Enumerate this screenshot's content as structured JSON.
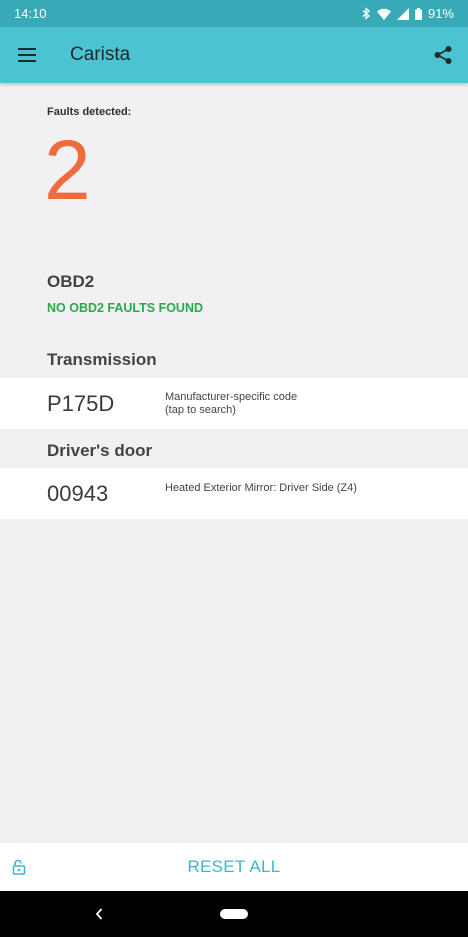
{
  "status_bar": {
    "time": "14:10",
    "battery": "91%"
  },
  "app_bar": {
    "title": "Carista"
  },
  "faults": {
    "label": "Faults detected:",
    "count": "2"
  },
  "sections": {
    "obd2": {
      "title": "OBD2",
      "status": "NO OBD2 FAULTS FOUND",
      "status_color": "#2aa84a"
    },
    "transmission": {
      "title": "Transmission",
      "code": "P175D",
      "desc_line1": "Manufacturer-specific code",
      "desc_line2": "(tap to search)"
    },
    "drivers_door": {
      "title": "Driver's door",
      "code": "00943",
      "desc_line1": "Heated Exterior Mirror: Driver Side (Z4)"
    }
  },
  "bottom_bar": {
    "reset_label": "RESET ALL"
  },
  "colors": {
    "accent": "#4cc3d1",
    "status_bar": "#37a9b7",
    "fault_count": "#f06a3c"
  },
  "icons": [
    "bluetooth-icon",
    "wifi-icon",
    "signal-icon",
    "battery-icon",
    "menu-icon",
    "share-icon",
    "unlock-icon",
    "back-icon"
  ]
}
